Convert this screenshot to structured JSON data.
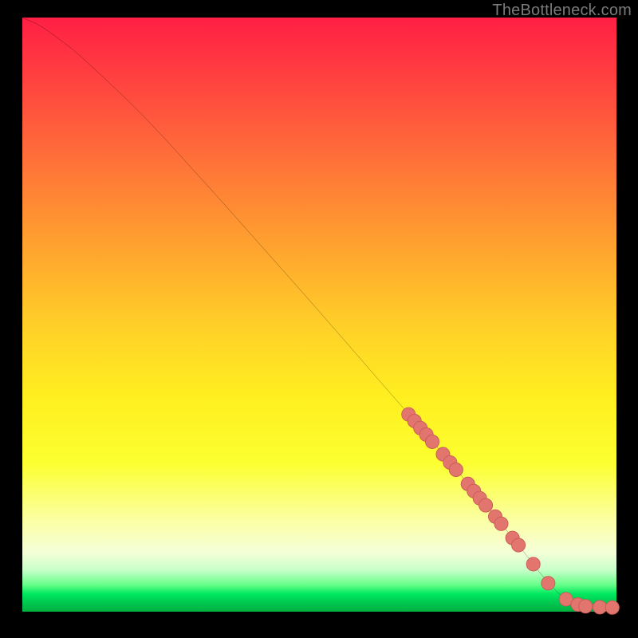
{
  "watermark": "TheBottleneck.com",
  "colors": {
    "background": "#000000",
    "curve": "#000000",
    "marker_fill": "#e2766f",
    "marker_stroke": "#c95a55"
  },
  "chart_data": {
    "type": "line",
    "title": "",
    "xlabel": "",
    "ylabel": "",
    "xlim": [
      0,
      100
    ],
    "ylim": [
      0,
      100
    ],
    "curve": {
      "x": [
        0,
        3,
        6,
        10,
        20,
        30,
        40,
        50,
        60,
        70,
        80,
        85,
        88,
        91,
        94,
        97,
        100
      ],
      "y": [
        100,
        98.6,
        96.5,
        93.3,
        83.8,
        73.0,
        61.8,
        50.5,
        39.0,
        27.5,
        15.5,
        9.3,
        5.5,
        2.5,
        1.1,
        0.75,
        0.7
      ]
    },
    "markers": [
      {
        "x": 65.0,
        "y": 33.2
      },
      {
        "x": 66.0,
        "y": 32.1
      },
      {
        "x": 67.0,
        "y": 30.9
      },
      {
        "x": 68.0,
        "y": 29.8
      },
      {
        "x": 69.0,
        "y": 28.6
      },
      {
        "x": 70.8,
        "y": 26.5
      },
      {
        "x": 72.0,
        "y": 25.1
      },
      {
        "x": 73.0,
        "y": 23.9
      },
      {
        "x": 75.0,
        "y": 21.5
      },
      {
        "x": 76.0,
        "y": 20.3
      },
      {
        "x": 77.0,
        "y": 19.1
      },
      {
        "x": 78.0,
        "y": 17.9
      },
      {
        "x": 79.6,
        "y": 16.0
      },
      {
        "x": 80.6,
        "y": 14.8
      },
      {
        "x": 82.5,
        "y": 12.4
      },
      {
        "x": 83.5,
        "y": 11.2
      },
      {
        "x": 86.0,
        "y": 8.0
      },
      {
        "x": 88.5,
        "y": 4.8
      },
      {
        "x": 91.5,
        "y": 2.1
      },
      {
        "x": 93.5,
        "y": 1.2
      },
      {
        "x": 94.8,
        "y": 0.9
      },
      {
        "x": 97.2,
        "y": 0.75
      },
      {
        "x": 99.3,
        "y": 0.7
      }
    ]
  }
}
